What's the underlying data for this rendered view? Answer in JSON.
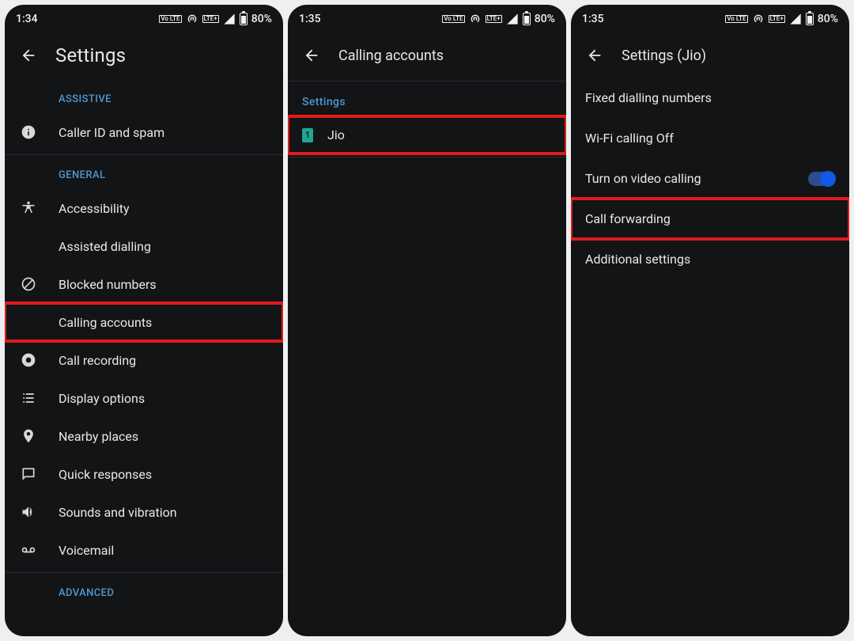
{
  "statusbar": {
    "time1": "1:34",
    "time2": "1:35",
    "time3": "1:35",
    "battery": "80%",
    "lte": "LTE+",
    "volte": "Vo LTE"
  },
  "screen1": {
    "title": "Settings",
    "sections": {
      "assistive": "ASSISTIVE",
      "general": "GENERAL",
      "advanced": "ADVANCED"
    },
    "items": {
      "caller_id": "Caller ID and spam",
      "accessibility": "Accessibility",
      "assisted_dialling": "Assisted dialling",
      "blocked_numbers": "Blocked numbers",
      "calling_accounts": "Calling accounts",
      "call_recording": "Call recording",
      "display_options": "Display options",
      "nearby_places": "Nearby places",
      "quick_responses": "Quick responses",
      "sounds_vibration": "Sounds and vibration",
      "voicemail": "Voicemail"
    }
  },
  "screen2": {
    "title": "Calling accounts",
    "section": "Settings",
    "sim_index": "1",
    "sim_name": "Jio"
  },
  "screen3": {
    "title": "Settings (Jio)",
    "items": {
      "fixed_dialling": "Fixed dialling numbers",
      "wifi_calling": "Wi-Fi calling",
      "wifi_calling_state": "Off",
      "video_calling": "Turn on video calling",
      "call_forwarding": "Call forwarding",
      "additional_settings": "Additional settings"
    }
  }
}
